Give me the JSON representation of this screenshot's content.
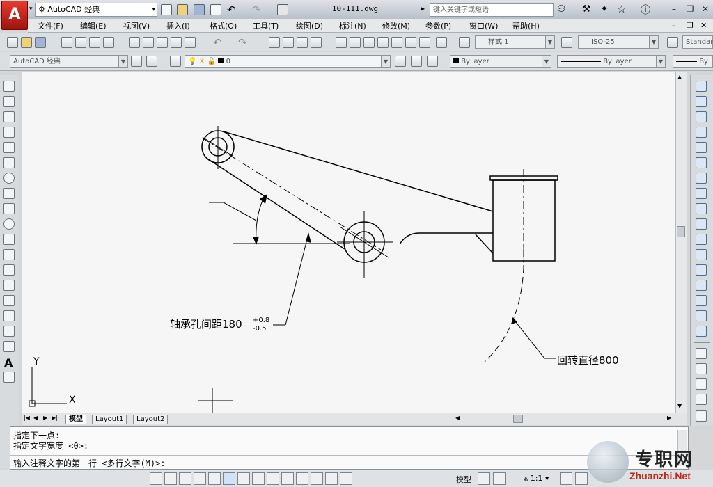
{
  "app": {
    "logo_letter": "A",
    "workspace": "AutoCAD 经典",
    "document_title": "10-111.dwg",
    "search_placeholder": "键入关键字或短语"
  },
  "menu": {
    "items": [
      "文件(F)",
      "编辑(E)",
      "视图(V)",
      "插入(I)",
      "格式(O)",
      "工具(T)",
      "绘图(D)",
      "标注(N)",
      "修改(M)",
      "参数(P)",
      "窗口(W)",
      "帮助(H)"
    ]
  },
  "toolbars": {
    "text_style": "样式 1",
    "dim_style": "ISO-25",
    "table_style": "Standard",
    "workspace_combo": "AutoCAD 经典",
    "layer": "0",
    "color": "ByLayer",
    "linetype": "ByLayer",
    "lineweight": "By"
  },
  "drawing": {
    "annotation_bearing": "轴承孔间距180",
    "tol_upper": "+0.8",
    "tol_lower": "-0.5",
    "annotation_radius": "回转直径800",
    "ucs_x": "X",
    "ucs_y": "Y"
  },
  "layout_tabs": [
    "模型",
    "Layout1",
    "Layout2"
  ],
  "command": {
    "lines": [
      "指定下一点:",
      "指定文字宽度 <0>:"
    ],
    "prompt": "输入注释文字的第一行 <多行文字(M)>:"
  },
  "status": {
    "model_label": "模型",
    "scale": "1:1"
  },
  "watermark": {
    "brand": "专职网",
    "url": "Zhuanzhi.Net"
  },
  "colors": {
    "logo_red": "#c3251c",
    "canvas_bg": "#f6f6f6"
  }
}
